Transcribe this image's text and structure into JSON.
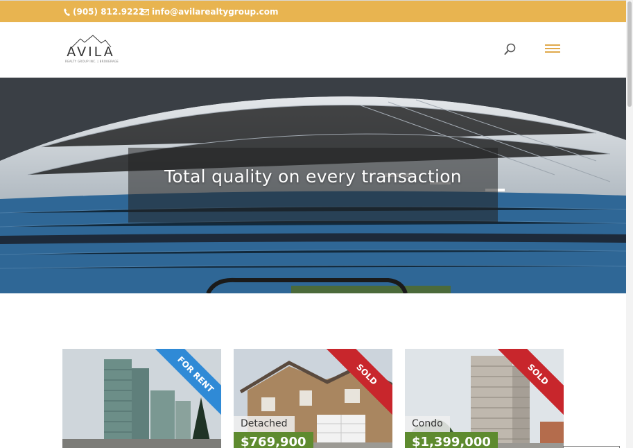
{
  "topbar": {
    "phone": "(905) 812.9222",
    "email": "info@avilarealtygroup.com",
    "icons": [
      "phone-icon",
      "envelope-icon"
    ],
    "color": "#e8b450"
  },
  "header": {
    "logo_text": "AVILA",
    "logo_tagline": "REALTY GROUP INC. | BROKERAGE",
    "icons": [
      "search-icon",
      "hamburger-menu-icon"
    ],
    "accent": "#e0a84a"
  },
  "hero": {
    "title": "Total quality on every transaction"
  },
  "listings": [
    {
      "ribbon": "FOR RENT",
      "type": "",
      "price": ""
    },
    {
      "ribbon": "SOLD",
      "type": "Detached",
      "price": "$769,900"
    },
    {
      "ribbon": "SOLD",
      "type": "Condo",
      "price": "$1,399,000"
    }
  ],
  "colors": {
    "rent_ribbon": "#2f8ad6",
    "sold_ribbon": "#c8262c",
    "price_tag": "#5e8b2f"
  }
}
